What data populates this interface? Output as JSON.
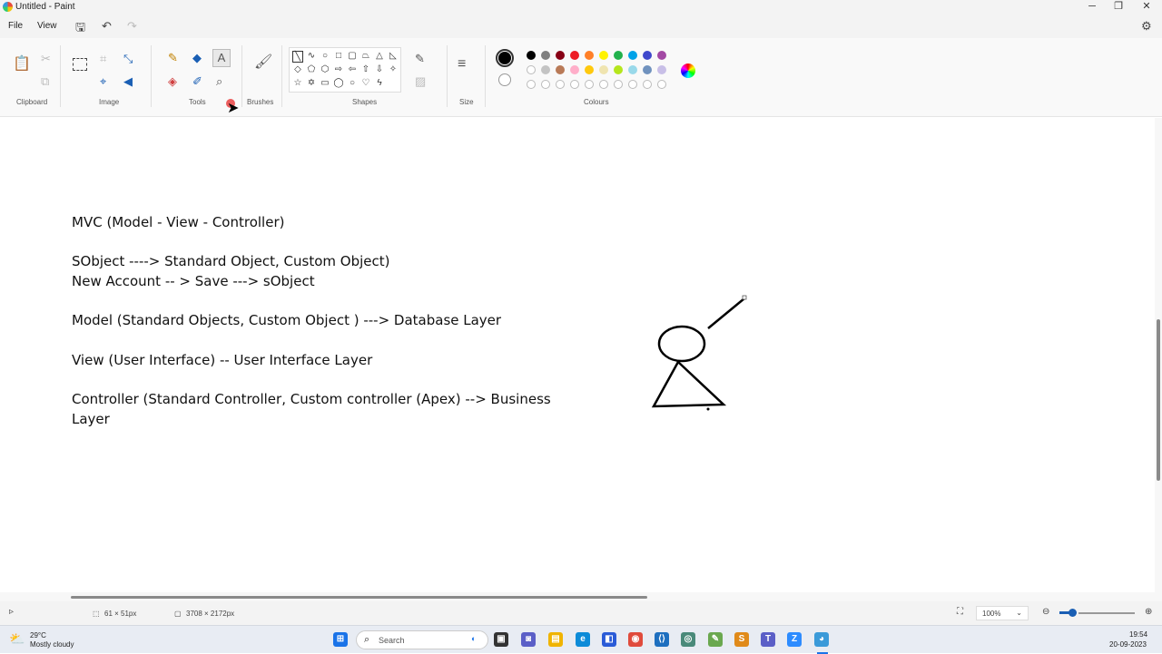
{
  "window": {
    "title": "Untitled - Paint",
    "minimize": "─",
    "restore": "❐",
    "close": "✕"
  },
  "menu": {
    "file": "File",
    "view": "View"
  },
  "ribbon": {
    "groups": {
      "clipboard": "Clipboard",
      "image": "Image",
      "tools": "Tools",
      "brushes": "Brushes",
      "shapes": "Shapes",
      "size": "Size",
      "colours": "Colours"
    },
    "colors_row1": [
      "#000000",
      "#7f7f7f",
      "#880015",
      "#ed1c24",
      "#ff7f27",
      "#fff200",
      "#22b14c",
      "#00a2e8",
      "#3f48cc",
      "#a349a4"
    ],
    "colors_row2": [
      "",
      "#c3c3c3",
      "#b97a57",
      "#ffaec9",
      "#ffc90e",
      "#efe4b0",
      "#b5e61d",
      "#99d9ea",
      "#7092be",
      "#c8bfe7"
    ]
  },
  "canvas": {
    "lines": [
      "MVC (Model - View - Controller)",
      "SObject ----> Standard Object, Custom Object)",
      "New Account -- > Save ---> sObject",
      "Model (Standard Objects, Custom Object ) ---> Database Layer",
      "View (User Interface) -- User Interface Layer",
      "Controller (Standard Controller, Custom controller (Apex) --> Business",
      "Layer"
    ]
  },
  "status": {
    "selection_size": "61 × 51px",
    "canvas_size": "3708 × 2172px",
    "zoom": "100%"
  },
  "taskbar": {
    "weather_temp": "29°C",
    "weather_desc": "Mostly cloudy",
    "search_placeholder": "Search",
    "time": "19:54",
    "date": "20-09-2023"
  }
}
